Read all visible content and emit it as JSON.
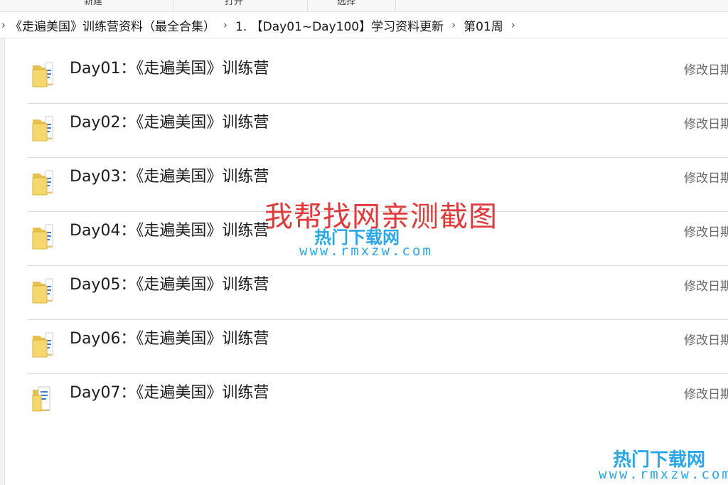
{
  "ribbon": {
    "labels": [
      "新建",
      "打开",
      "选择"
    ]
  },
  "breadcrumb": {
    "items": [
      "《走遍美国》训练营资料（最全合集）",
      "1. 【Day01~Day100】学习资料更新",
      "第01周"
    ]
  },
  "file_list": {
    "meta_label": "修改日期",
    "items": [
      {
        "name": "Day01：《走遍美国》训练营",
        "icon": "folder-icon"
      },
      {
        "name": "Day02：《走遍美国》训练营",
        "icon": "folder-icon"
      },
      {
        "name": "Day03：《走遍美国》训练营",
        "icon": "folder-icon"
      },
      {
        "name": "Day04：《走遍美国》训练营",
        "icon": "folder-icon"
      },
      {
        "name": "Day05：《走遍美国》训练营",
        "icon": "folder-icon"
      },
      {
        "name": "Day06：《走遍美国》训练营",
        "icon": "folder-icon"
      },
      {
        "name": "Day07：《走遍美国》训练营",
        "icon": "folder-open-icon"
      }
    ]
  },
  "watermarks": {
    "main": "我帮找网亲测截图",
    "site_title": "热门下载网",
    "site_url": "www.rmxzw.com"
  },
  "colors": {
    "watermark_red": "#e03a3a",
    "watermark_blue": "#2aa7e8",
    "folder_yellow": "#f5d76e"
  }
}
